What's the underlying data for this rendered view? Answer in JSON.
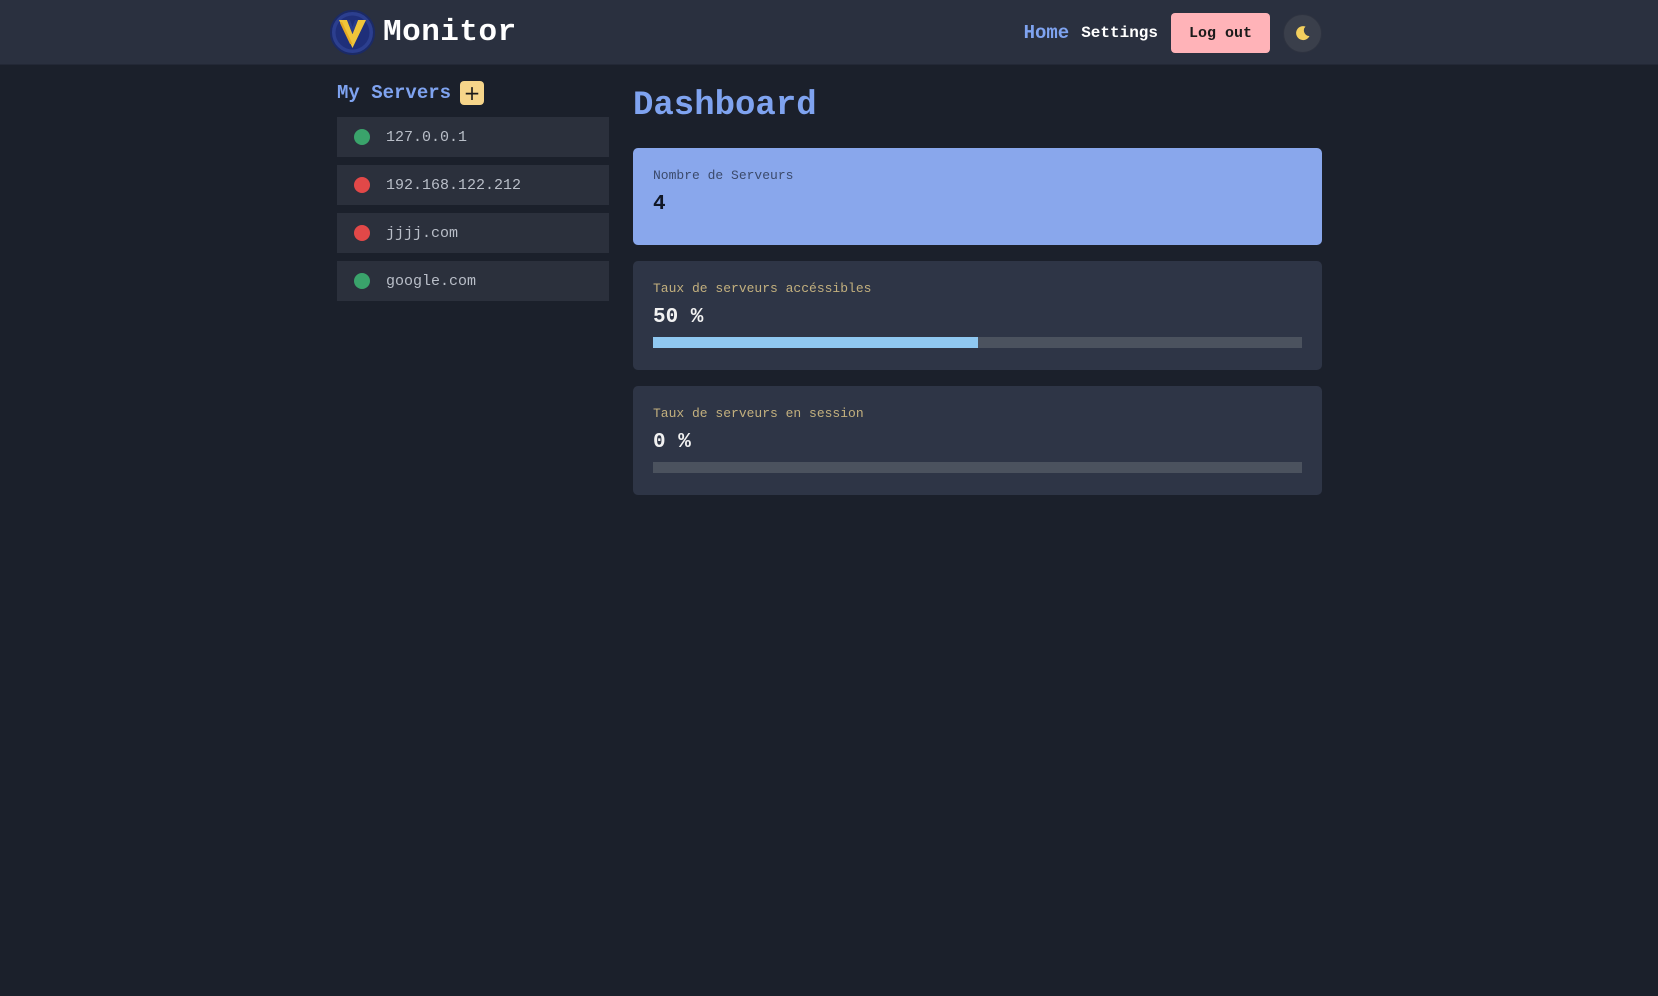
{
  "header": {
    "brand": "Monitor",
    "nav_home": "Home",
    "nav_settings": "Settings",
    "logout_label": "Log out",
    "theme_icon": "moon-icon"
  },
  "sidebar": {
    "title": "My Servers",
    "add_label": "+",
    "servers": [
      {
        "name": "127.0.0.1",
        "status": "up",
        "status_color": "#3aa36b"
      },
      {
        "name": "192.168.122.212",
        "status": "down",
        "status_color": "#e24848"
      },
      {
        "name": "jjjj.com",
        "status": "down",
        "status_color": "#e24848"
      },
      {
        "name": "google.com",
        "status": "up",
        "status_color": "#3aa36b"
      }
    ]
  },
  "main": {
    "title": "Dashboard",
    "cards": [
      {
        "label": "Nombre de Serveurs",
        "value": "4"
      },
      {
        "label": "Taux de serveurs accéssibles",
        "value": "50 %",
        "progress": 0.5
      },
      {
        "label": "Taux de serveurs en session",
        "value": "0 %",
        "progress": 0.0
      }
    ]
  },
  "colors": {
    "accent": "#7fa3f0",
    "highlight_card": "#89a7ec",
    "progress_fill": "#8fc8f1",
    "logout_bg": "#ffb3b8",
    "add_bg": "#f6d58a",
    "status_up": "#3aa36b",
    "status_down": "#e24848"
  }
}
